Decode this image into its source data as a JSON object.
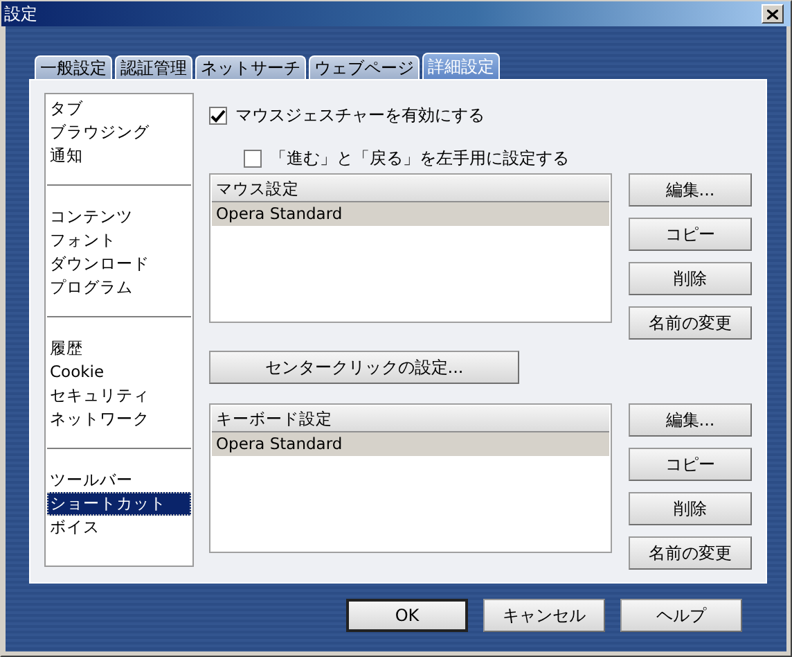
{
  "window": {
    "title": "設定"
  },
  "tabs": [
    {
      "label": "一般設定",
      "selected": false
    },
    {
      "label": "認証管理",
      "selected": false
    },
    {
      "label": "ネットサーチ",
      "selected": false
    },
    {
      "label": "ウェブページ",
      "selected": false
    },
    {
      "label": "詳細設定",
      "selected": true
    }
  ],
  "sidebar": {
    "groups": [
      {
        "items": [
          {
            "label": "タブ",
            "selected": false
          },
          {
            "label": "ブラウジング",
            "selected": false
          },
          {
            "label": "通知",
            "selected": false
          }
        ]
      },
      {
        "items": [
          {
            "label": "コンテンツ",
            "selected": false
          },
          {
            "label": "フォント",
            "selected": false
          },
          {
            "label": "ダウンロード",
            "selected": false
          },
          {
            "label": "プログラム",
            "selected": false
          }
        ]
      },
      {
        "items": [
          {
            "label": "履歴",
            "selected": false
          },
          {
            "label": "Cookie",
            "selected": false
          },
          {
            "label": "セキュリティ",
            "selected": false
          },
          {
            "label": "ネットワーク",
            "selected": false
          }
        ]
      },
      {
        "items": [
          {
            "label": "ツールバー",
            "selected": false
          },
          {
            "label": "ショートカット",
            "selected": true
          },
          {
            "label": "ボイス",
            "selected": false
          }
        ]
      }
    ]
  },
  "options": [
    {
      "label": "マウスジェスチャーを有効にする",
      "checked": true,
      "children": [
        {
          "label": "「進む」と「戻る」を左手用に設定する",
          "checked": false
        }
      ]
    }
  ],
  "mouse_setup": {
    "header": "マウス設定",
    "rows": [
      {
        "label": "Opera Standard",
        "selected": true
      }
    ],
    "buttons": [
      "編集...",
      "コピー",
      "削除",
      "名前の変更"
    ]
  },
  "center_click_button": "センタークリックの設定...",
  "keyboard_setup": {
    "header": "キーボード設定",
    "rows": [
      {
        "label": "Opera Standard",
        "selected": true
      }
    ],
    "buttons": [
      "編集...",
      "コピー",
      "削除",
      "名前の変更"
    ]
  },
  "dialog_buttons": [
    {
      "label": "OK",
      "default": true
    },
    {
      "label": "キャンセル",
      "default": false
    },
    {
      "label": "ヘルプ",
      "default": false
    }
  ]
}
